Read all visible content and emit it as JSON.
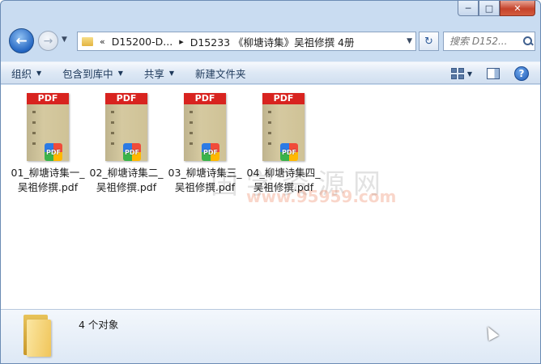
{
  "window": {
    "min_glyph": "─",
    "max_glyph": "□",
    "close_glyph": "✕"
  },
  "address": {
    "back_glyph": "←",
    "fwd_glyph": "→",
    "chevron": "«",
    "crumbs": [
      "D15200-D...",
      "D15233 《柳塘诗集》吴祖修撰 4册"
    ],
    "separator": "▸",
    "refresh_glyph": "↻",
    "search_placeholder": "搜索 D152..."
  },
  "toolbar": {
    "organize": "组织",
    "include_in_library": "包含到库中",
    "share": "共享",
    "new_folder": "新建文件夹"
  },
  "files": [
    {
      "line1": "01_柳塘诗集一_",
      "line2": "吴祖修撰.pdf"
    },
    {
      "line1": "02_柳塘诗集二_",
      "line2": "吴祖修撰.pdf"
    },
    {
      "line1": "03_柳塘诗集三_",
      "line2": "吴祖修撰.pdf"
    },
    {
      "line1": "04_柳塘诗集四_",
      "line2": "吴祖修撰.pdf"
    }
  ],
  "pdf_label": "PDF",
  "badge_label": "PDF",
  "watermark": {
    "text": "国学资源网",
    "url": "www.95959.com"
  },
  "details": {
    "count": "4 个对象"
  },
  "colors": {
    "pdf_red": "#d8231f",
    "window_frame": "#c9dcf1",
    "toolbar": "#dde8f5"
  }
}
